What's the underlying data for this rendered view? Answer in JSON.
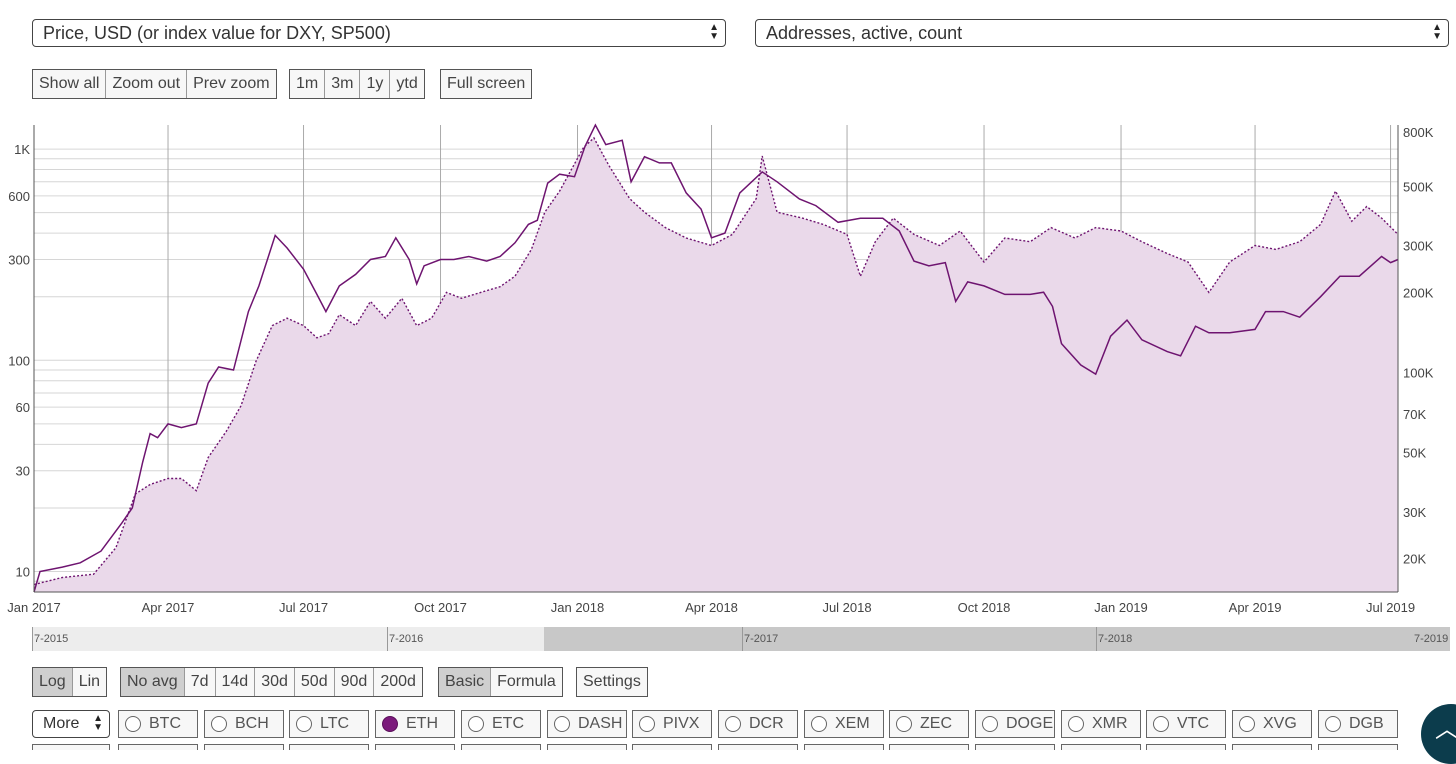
{
  "metric_select_left": "Price, USD (or index value for DXY, SP500)",
  "metric_select_right": "Addresses, active, count",
  "zoom_buttons": [
    "Show all",
    "Zoom out",
    "Prev zoom"
  ],
  "range_buttons": [
    "1m",
    "3m",
    "1y",
    "ytd"
  ],
  "fullscreen_label": "Full screen",
  "scale_buttons": [
    {
      "label": "Log",
      "active": true
    },
    {
      "label": "Lin",
      "active": false
    }
  ],
  "avg_buttons": [
    {
      "label": "No avg",
      "active": true
    },
    {
      "label": "7d"
    },
    {
      "label": "14d"
    },
    {
      "label": "30d"
    },
    {
      "label": "50d"
    },
    {
      "label": "90d"
    },
    {
      "label": "200d"
    }
  ],
  "mode_buttons": [
    {
      "label": "Basic",
      "active": true
    },
    {
      "label": "Formula",
      "active": false
    }
  ],
  "settings_label": "Settings",
  "more_label": "More",
  "coins": [
    {
      "label": "BTC",
      "checked": false
    },
    {
      "label": "BCH",
      "checked": false
    },
    {
      "label": "LTC",
      "checked": false
    },
    {
      "label": "ETH",
      "checked": true
    },
    {
      "label": "ETC",
      "checked": false
    },
    {
      "label": "DASH",
      "checked": false
    },
    {
      "label": "PIVX",
      "checked": false
    },
    {
      "label": "DCR",
      "checked": false
    },
    {
      "label": "XEM",
      "checked": false
    },
    {
      "label": "ZEC",
      "checked": false
    },
    {
      "label": "DOGE",
      "checked": false
    },
    {
      "label": "XMR",
      "checked": false
    },
    {
      "label": "VTC",
      "checked": false
    },
    {
      "label": "XVG",
      "checked": false
    },
    {
      "label": "DGB",
      "checked": false
    }
  ],
  "navigator_labels": [
    "7-2015",
    "7-2016",
    "7-2017",
    "7-2018",
    "7-2019"
  ],
  "fab_icon": "chevron-up-icon",
  "colors": {
    "series": "#6e1470",
    "area": "#ead9ea",
    "grid": "#d6d6d6",
    "vgrid": "#aaaaaa"
  },
  "chart_data": {
    "type": "line",
    "title": "",
    "x_tick_labels": [
      "Jan 2017",
      "Apr 2017",
      "Jul 2017",
      "Oct 2017",
      "Jan 2018",
      "Apr 2018",
      "Jul 2018",
      "Oct 2018",
      "Jan 2019",
      "Apr 2019",
      "Jul 2019"
    ],
    "y_left": {
      "scale": "log",
      "range": [
        8,
        1300
      ],
      "tick_labels": [
        "10",
        "30",
        "60",
        "100",
        "300",
        "600",
        "1K"
      ],
      "tick_values": [
        10,
        30,
        60,
        100,
        300,
        600,
        1000
      ]
    },
    "y_right": {
      "scale": "log",
      "range": [
        15000,
        850000
      ],
      "tick_labels": [
        "20K",
        "30K",
        "50K",
        "70K",
        "100K",
        "200K",
        "300K",
        "500K",
        "800K"
      ],
      "tick_values": [
        20000,
        30000,
        50000,
        70000,
        100000,
        200000,
        300000,
        500000,
        800000
      ]
    },
    "x_range": [
      "2017-01-01",
      "2019-07-06"
    ],
    "series": [
      {
        "axis": "left",
        "style": "solid",
        "points": [
          [
            "2017-01-01",
            8
          ],
          [
            "2017-01-05",
            10
          ],
          [
            "2017-01-20",
            10.5
          ],
          [
            "2017-02-01",
            11
          ],
          [
            "2017-02-15",
            12.5
          ],
          [
            "2017-03-01",
            17
          ],
          [
            "2017-03-08",
            20
          ],
          [
            "2017-03-15",
            33
          ],
          [
            "2017-03-20",
            45
          ],
          [
            "2017-03-25",
            43
          ],
          [
            "2017-04-01",
            50
          ],
          [
            "2017-04-10",
            48
          ],
          [
            "2017-04-20",
            50
          ],
          [
            "2017-04-28",
            78
          ],
          [
            "2017-05-05",
            93
          ],
          [
            "2017-05-15",
            90
          ],
          [
            "2017-05-25",
            170
          ],
          [
            "2017-06-01",
            225
          ],
          [
            "2017-06-12",
            390
          ],
          [
            "2017-06-20",
            340
          ],
          [
            "2017-07-01",
            270
          ],
          [
            "2017-07-10",
            205
          ],
          [
            "2017-07-16",
            170
          ],
          [
            "2017-07-25",
            225
          ],
          [
            "2017-08-05",
            255
          ],
          [
            "2017-08-15",
            300
          ],
          [
            "2017-08-25",
            310
          ],
          [
            "2017-09-01",
            380
          ],
          [
            "2017-09-10",
            300
          ],
          [
            "2017-09-15",
            230
          ],
          [
            "2017-09-20",
            280
          ],
          [
            "2017-10-01",
            300
          ],
          [
            "2017-10-10",
            300
          ],
          [
            "2017-10-20",
            310
          ],
          [
            "2017-11-01",
            295
          ],
          [
            "2017-11-10",
            310
          ],
          [
            "2017-11-20",
            360
          ],
          [
            "2017-11-29",
            440
          ],
          [
            "2017-12-05",
            460
          ],
          [
            "2017-12-12",
            690
          ],
          [
            "2017-12-20",
            760
          ],
          [
            "2017-12-30",
            740
          ],
          [
            "2018-01-06",
            1030
          ],
          [
            "2018-01-13",
            1300
          ],
          [
            "2018-01-20",
            1050
          ],
          [
            "2018-01-31",
            1100
          ],
          [
            "2018-02-06",
            700
          ],
          [
            "2018-02-15",
            920
          ],
          [
            "2018-02-25",
            860
          ],
          [
            "2018-03-05",
            860
          ],
          [
            "2018-03-15",
            620
          ],
          [
            "2018-03-25",
            520
          ],
          [
            "2018-04-01",
            380
          ],
          [
            "2018-04-10",
            400
          ],
          [
            "2018-04-20",
            620
          ],
          [
            "2018-05-05",
            780
          ],
          [
            "2018-05-15",
            700
          ],
          [
            "2018-05-30",
            580
          ],
          [
            "2018-06-10",
            540
          ],
          [
            "2018-06-25",
            450
          ],
          [
            "2018-07-10",
            470
          ],
          [
            "2018-07-25",
            470
          ],
          [
            "2018-08-05",
            410
          ],
          [
            "2018-08-15",
            295
          ],
          [
            "2018-08-25",
            280
          ],
          [
            "2018-09-05",
            290
          ],
          [
            "2018-09-12",
            190
          ],
          [
            "2018-09-20",
            235
          ],
          [
            "2018-10-01",
            225
          ],
          [
            "2018-10-15",
            205
          ],
          [
            "2018-11-01",
            205
          ],
          [
            "2018-11-10",
            210
          ],
          [
            "2018-11-16",
            180
          ],
          [
            "2018-11-22",
            120
          ],
          [
            "2018-12-05",
            95
          ],
          [
            "2018-12-15",
            86
          ],
          [
            "2018-12-25",
            130
          ],
          [
            "2019-01-05",
            155
          ],
          [
            "2019-01-15",
            125
          ],
          [
            "2019-02-01",
            110
          ],
          [
            "2019-02-10",
            105
          ],
          [
            "2019-02-20",
            145
          ],
          [
            "2019-03-01",
            135
          ],
          [
            "2019-03-15",
            135
          ],
          [
            "2019-04-01",
            140
          ],
          [
            "2019-04-08",
            170
          ],
          [
            "2019-04-20",
            170
          ],
          [
            "2019-05-01",
            160
          ],
          [
            "2019-05-15",
            200
          ],
          [
            "2019-05-28",
            250
          ],
          [
            "2019-06-10",
            250
          ],
          [
            "2019-06-25",
            310
          ],
          [
            "2019-07-01",
            290
          ],
          [
            "2019-07-06",
            300
          ]
        ]
      },
      {
        "axis": "right",
        "style": "dotted",
        "points": [
          [
            "2017-01-01",
            16000
          ],
          [
            "2017-01-20",
            17000
          ],
          [
            "2017-02-10",
            17500
          ],
          [
            "2017-02-25",
            22000
          ],
          [
            "2017-03-10",
            35000
          ],
          [
            "2017-03-20",
            38000
          ],
          [
            "2017-04-01",
            40000
          ],
          [
            "2017-04-10",
            40000
          ],
          [
            "2017-04-20",
            36000
          ],
          [
            "2017-04-28",
            48000
          ],
          [
            "2017-05-10",
            60000
          ],
          [
            "2017-05-20",
            75000
          ],
          [
            "2017-05-30",
            110000
          ],
          [
            "2017-06-10",
            150000
          ],
          [
            "2017-06-20",
            160000
          ],
          [
            "2017-07-01",
            150000
          ],
          [
            "2017-07-10",
            135000
          ],
          [
            "2017-07-18",
            140000
          ],
          [
            "2017-07-25",
            165000
          ],
          [
            "2017-08-05",
            150000
          ],
          [
            "2017-08-15",
            185000
          ],
          [
            "2017-08-25",
            160000
          ],
          [
            "2017-09-05",
            190000
          ],
          [
            "2017-09-15",
            150000
          ],
          [
            "2017-09-25",
            160000
          ],
          [
            "2017-10-05",
            200000
          ],
          [
            "2017-10-15",
            190000
          ],
          [
            "2017-10-28",
            200000
          ],
          [
            "2017-11-10",
            210000
          ],
          [
            "2017-11-20",
            230000
          ],
          [
            "2017-12-01",
            290000
          ],
          [
            "2017-12-10",
            400000
          ],
          [
            "2017-12-20",
            480000
          ],
          [
            "2018-01-05",
            700000
          ],
          [
            "2018-01-12",
            760000
          ],
          [
            "2018-01-22",
            600000
          ],
          [
            "2018-02-05",
            450000
          ],
          [
            "2018-02-15",
            400000
          ],
          [
            "2018-03-01",
            350000
          ],
          [
            "2018-03-15",
            320000
          ],
          [
            "2018-04-01",
            300000
          ],
          [
            "2018-04-15",
            330000
          ],
          [
            "2018-05-01",
            450000
          ],
          [
            "2018-05-05",
            650000
          ],
          [
            "2018-05-15",
            400000
          ],
          [
            "2018-06-01",
            380000
          ],
          [
            "2018-06-15",
            360000
          ],
          [
            "2018-07-01",
            330000
          ],
          [
            "2018-07-10",
            230000
          ],
          [
            "2018-07-20",
            310000
          ],
          [
            "2018-08-01",
            380000
          ],
          [
            "2018-08-15",
            330000
          ],
          [
            "2018-09-01",
            300000
          ],
          [
            "2018-09-15",
            340000
          ],
          [
            "2018-10-01",
            260000
          ],
          [
            "2018-10-15",
            320000
          ],
          [
            "2018-11-01",
            310000
          ],
          [
            "2018-11-15",
            350000
          ],
          [
            "2018-12-01",
            320000
          ],
          [
            "2018-12-15",
            350000
          ],
          [
            "2019-01-01",
            340000
          ],
          [
            "2019-01-15",
            310000
          ],
          [
            "2019-02-01",
            280000
          ],
          [
            "2019-02-15",
            260000
          ],
          [
            "2019-03-01",
            200000
          ],
          [
            "2019-03-15",
            260000
          ],
          [
            "2019-04-01",
            300000
          ],
          [
            "2019-04-15",
            290000
          ],
          [
            "2019-05-01",
            310000
          ],
          [
            "2019-05-15",
            360000
          ],
          [
            "2019-05-25",
            480000
          ],
          [
            "2019-06-05",
            370000
          ],
          [
            "2019-06-15",
            420000
          ],
          [
            "2019-06-25",
            380000
          ],
          [
            "2019-07-06",
            330000
          ]
        ]
      }
    ]
  }
}
